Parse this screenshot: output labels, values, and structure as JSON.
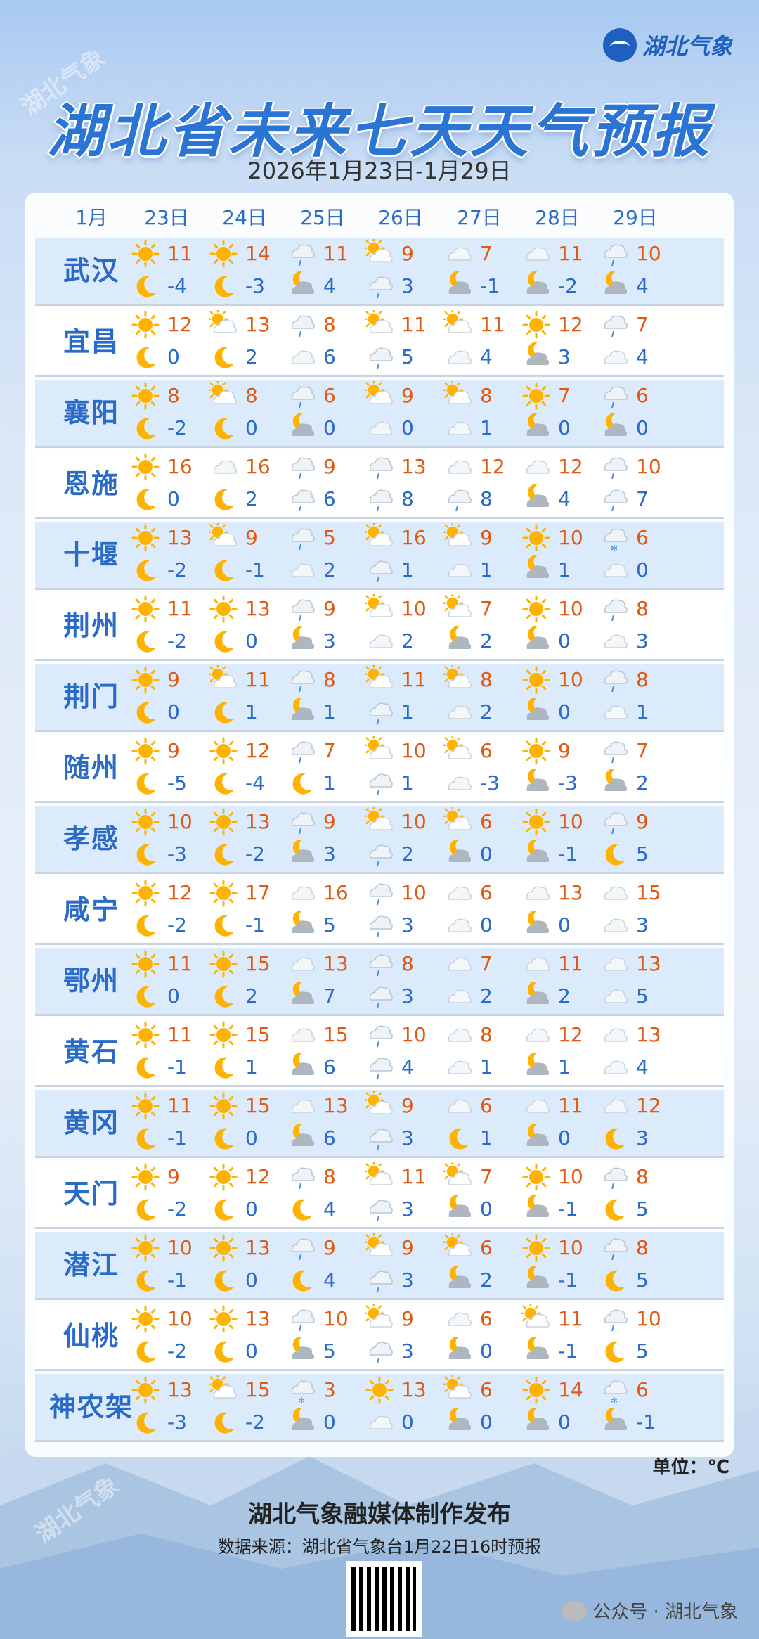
{
  "header": {
    "logo_text": "湖北气象",
    "title": "湖北省未来七天天气预报",
    "subtitle": "2026年1月23日-1月29日",
    "watermark": "湖北气象"
  },
  "table": {
    "month_label": "1月",
    "days": [
      "23日",
      "24日",
      "25日",
      "26日",
      "27日",
      "28日",
      "29日"
    ],
    "rows": [
      {
        "city": "武汉",
        "cells": [
          {
            "hi": "11",
            "lo": "-4",
            "d": "sunny",
            "n": "moon"
          },
          {
            "hi": "14",
            "lo": "-3",
            "d": "sunny",
            "n": "moon"
          },
          {
            "hi": "11",
            "lo": "4",
            "d": "rain",
            "n": "cloud-moon"
          },
          {
            "hi": "9",
            "lo": "3",
            "d": "partly",
            "n": "rain"
          },
          {
            "hi": "7",
            "lo": "-1",
            "d": "cloud",
            "n": "cloud-moon"
          },
          {
            "hi": "11",
            "lo": "-2",
            "d": "cloud",
            "n": "cloud-moon"
          },
          {
            "hi": "10",
            "lo": "4",
            "d": "rain",
            "n": "cloud-moon"
          }
        ]
      },
      {
        "city": "宜昌",
        "cells": [
          {
            "hi": "12",
            "lo": "0",
            "d": "sunny",
            "n": "moon"
          },
          {
            "hi": "13",
            "lo": "2",
            "d": "partly",
            "n": "moon"
          },
          {
            "hi": "8",
            "lo": "6",
            "d": "rain",
            "n": "cloud"
          },
          {
            "hi": "11",
            "lo": "5",
            "d": "partly",
            "n": "rain"
          },
          {
            "hi": "11",
            "lo": "4",
            "d": "partly",
            "n": "cloud"
          },
          {
            "hi": "12",
            "lo": "3",
            "d": "sunny",
            "n": "cloud-moon"
          },
          {
            "hi": "7",
            "lo": "4",
            "d": "rain",
            "n": "cloud"
          }
        ]
      },
      {
        "city": "襄阳",
        "cells": [
          {
            "hi": "8",
            "lo": "-2",
            "d": "sunny",
            "n": "moon"
          },
          {
            "hi": "8",
            "lo": "0",
            "d": "partly",
            "n": "moon"
          },
          {
            "hi": "6",
            "lo": "0",
            "d": "rain",
            "n": "cloud-moon"
          },
          {
            "hi": "9",
            "lo": "0",
            "d": "partly",
            "n": "cloud"
          },
          {
            "hi": "8",
            "lo": "1",
            "d": "partly",
            "n": "cloud"
          },
          {
            "hi": "7",
            "lo": "0",
            "d": "sunny",
            "n": "cloud-moon"
          },
          {
            "hi": "6",
            "lo": "0",
            "d": "rain",
            "n": "cloud-moon"
          }
        ]
      },
      {
        "city": "恩施",
        "cells": [
          {
            "hi": "16",
            "lo": "0",
            "d": "sunny",
            "n": "moon"
          },
          {
            "hi": "16",
            "lo": "2",
            "d": "cloud",
            "n": "moon"
          },
          {
            "hi": "9",
            "lo": "6",
            "d": "rain",
            "n": "rain"
          },
          {
            "hi": "13",
            "lo": "8",
            "d": "rain",
            "n": "rain"
          },
          {
            "hi": "12",
            "lo": "8",
            "d": "cloud",
            "n": "rain"
          },
          {
            "hi": "12",
            "lo": "4",
            "d": "cloud",
            "n": "cloud-moon"
          },
          {
            "hi": "10",
            "lo": "7",
            "d": "rain",
            "n": "rain"
          }
        ]
      },
      {
        "city": "十堰",
        "cells": [
          {
            "hi": "13",
            "lo": "-2",
            "d": "sunny",
            "n": "moon"
          },
          {
            "hi": "9",
            "lo": "-1",
            "d": "partly",
            "n": "moon"
          },
          {
            "hi": "5",
            "lo": "2",
            "d": "rain",
            "n": "cloud"
          },
          {
            "hi": "16",
            "lo": "1",
            "d": "partly",
            "n": "rain"
          },
          {
            "hi": "9",
            "lo": "1",
            "d": "partly",
            "n": "cloud"
          },
          {
            "hi": "10",
            "lo": "1",
            "d": "sunny",
            "n": "cloud-moon"
          },
          {
            "hi": "6",
            "lo": "0",
            "d": "snow",
            "n": "cloud"
          }
        ]
      },
      {
        "city": "荆州",
        "cells": [
          {
            "hi": "11",
            "lo": "-2",
            "d": "sunny",
            "n": "moon"
          },
          {
            "hi": "13",
            "lo": "0",
            "d": "sunny",
            "n": "moon"
          },
          {
            "hi": "9",
            "lo": "3",
            "d": "rain",
            "n": "cloud-moon"
          },
          {
            "hi": "10",
            "lo": "2",
            "d": "partly",
            "n": "cloud"
          },
          {
            "hi": "7",
            "lo": "2",
            "d": "partly",
            "n": "cloud-moon"
          },
          {
            "hi": "10",
            "lo": "0",
            "d": "sunny",
            "n": "cloud-moon"
          },
          {
            "hi": "8",
            "lo": "3",
            "d": "rain",
            "n": "cloud"
          }
        ]
      },
      {
        "city": "荆门",
        "cells": [
          {
            "hi": "9",
            "lo": "0",
            "d": "sunny",
            "n": "moon"
          },
          {
            "hi": "11",
            "lo": "1",
            "d": "partly",
            "n": "moon"
          },
          {
            "hi": "8",
            "lo": "1",
            "d": "rain",
            "n": "cloud-moon"
          },
          {
            "hi": "11",
            "lo": "1",
            "d": "partly",
            "n": "rain"
          },
          {
            "hi": "8",
            "lo": "2",
            "d": "partly",
            "n": "cloud"
          },
          {
            "hi": "10",
            "lo": "0",
            "d": "sunny",
            "n": "cloud-moon"
          },
          {
            "hi": "8",
            "lo": "1",
            "d": "rain",
            "n": "cloud"
          }
        ]
      },
      {
        "city": "随州",
        "cells": [
          {
            "hi": "9",
            "lo": "-5",
            "d": "sunny",
            "n": "moon"
          },
          {
            "hi": "12",
            "lo": "-4",
            "d": "sunny",
            "n": "moon"
          },
          {
            "hi": "7",
            "lo": "1",
            "d": "rain",
            "n": "moon"
          },
          {
            "hi": "10",
            "lo": "1",
            "d": "partly",
            "n": "rain"
          },
          {
            "hi": "6",
            "lo": "-3",
            "d": "partly",
            "n": "cloud"
          },
          {
            "hi": "9",
            "lo": "-3",
            "d": "sunny",
            "n": "cloud-moon"
          },
          {
            "hi": "7",
            "lo": "2",
            "d": "rain",
            "n": "cloud-moon"
          }
        ]
      },
      {
        "city": "孝感",
        "cells": [
          {
            "hi": "10",
            "lo": "-3",
            "d": "sunny",
            "n": "moon"
          },
          {
            "hi": "13",
            "lo": "-2",
            "d": "sunny",
            "n": "moon"
          },
          {
            "hi": "9",
            "lo": "3",
            "d": "rain",
            "n": "cloud-moon"
          },
          {
            "hi": "10",
            "lo": "2",
            "d": "partly",
            "n": "rain"
          },
          {
            "hi": "6",
            "lo": "0",
            "d": "partly",
            "n": "cloud-moon"
          },
          {
            "hi": "10",
            "lo": "-1",
            "d": "sunny",
            "n": "cloud-moon"
          },
          {
            "hi": "9",
            "lo": "5",
            "d": "rain",
            "n": "moon"
          }
        ]
      },
      {
        "city": "咸宁",
        "cells": [
          {
            "hi": "12",
            "lo": "-2",
            "d": "sunny",
            "n": "moon"
          },
          {
            "hi": "17",
            "lo": "-1",
            "d": "sunny",
            "n": "moon"
          },
          {
            "hi": "16",
            "lo": "5",
            "d": "cloud",
            "n": "cloud-moon"
          },
          {
            "hi": "10",
            "lo": "3",
            "d": "rain",
            "n": "rain"
          },
          {
            "hi": "6",
            "lo": "0",
            "d": "cloud",
            "n": "cloud"
          },
          {
            "hi": "13",
            "lo": "0",
            "d": "cloud",
            "n": "cloud-moon"
          },
          {
            "hi": "15",
            "lo": "3",
            "d": "cloud",
            "n": "cloud"
          }
        ]
      },
      {
        "city": "鄂州",
        "cells": [
          {
            "hi": "11",
            "lo": "0",
            "d": "sunny",
            "n": "moon"
          },
          {
            "hi": "15",
            "lo": "2",
            "d": "sunny",
            "n": "moon"
          },
          {
            "hi": "13",
            "lo": "7",
            "d": "cloud",
            "n": "cloud-moon"
          },
          {
            "hi": "8",
            "lo": "3",
            "d": "rain",
            "n": "rain"
          },
          {
            "hi": "7",
            "lo": "2",
            "d": "cloud",
            "n": "cloud"
          },
          {
            "hi": "11",
            "lo": "2",
            "d": "cloud",
            "n": "cloud-moon"
          },
          {
            "hi": "13",
            "lo": "5",
            "d": "cloud",
            "n": "cloud"
          }
        ]
      },
      {
        "city": "黄石",
        "cells": [
          {
            "hi": "11",
            "lo": "-1",
            "d": "sunny",
            "n": "moon"
          },
          {
            "hi": "15",
            "lo": "1",
            "d": "sunny",
            "n": "moon"
          },
          {
            "hi": "15",
            "lo": "6",
            "d": "cloud",
            "n": "cloud-moon"
          },
          {
            "hi": "10",
            "lo": "4",
            "d": "rain",
            "n": "rain"
          },
          {
            "hi": "8",
            "lo": "1",
            "d": "cloud",
            "n": "cloud"
          },
          {
            "hi": "12",
            "lo": "1",
            "d": "cloud",
            "n": "cloud-moon"
          },
          {
            "hi": "13",
            "lo": "4",
            "d": "cloud",
            "n": "cloud"
          }
        ]
      },
      {
        "city": "黄冈",
        "cells": [
          {
            "hi": "11",
            "lo": "-1",
            "d": "sunny",
            "n": "moon"
          },
          {
            "hi": "15",
            "lo": "0",
            "d": "sunny",
            "n": "moon"
          },
          {
            "hi": "13",
            "lo": "6",
            "d": "cloud",
            "n": "cloud-moon"
          },
          {
            "hi": "9",
            "lo": "3",
            "d": "partly",
            "n": "rain"
          },
          {
            "hi": "6",
            "lo": "1",
            "d": "cloud",
            "n": "moon"
          },
          {
            "hi": "11",
            "lo": "0",
            "d": "cloud",
            "n": "cloud-moon"
          },
          {
            "hi": "12",
            "lo": "3",
            "d": "cloud",
            "n": "moon"
          }
        ]
      },
      {
        "city": "天门",
        "cells": [
          {
            "hi": "9",
            "lo": "-2",
            "d": "sunny",
            "n": "moon"
          },
          {
            "hi": "12",
            "lo": "0",
            "d": "sunny",
            "n": "moon"
          },
          {
            "hi": "8",
            "lo": "4",
            "d": "rain",
            "n": "moon"
          },
          {
            "hi": "11",
            "lo": "3",
            "d": "partly",
            "n": "rain"
          },
          {
            "hi": "7",
            "lo": "0",
            "d": "partly",
            "n": "cloud-moon"
          },
          {
            "hi": "10",
            "lo": "-1",
            "d": "sunny",
            "n": "cloud-moon"
          },
          {
            "hi": "8",
            "lo": "5",
            "d": "rain",
            "n": "moon"
          }
        ]
      },
      {
        "city": "潜江",
        "cells": [
          {
            "hi": "10",
            "lo": "-1",
            "d": "sunny",
            "n": "moon"
          },
          {
            "hi": "13",
            "lo": "0",
            "d": "sunny",
            "n": "moon"
          },
          {
            "hi": "9",
            "lo": "4",
            "d": "rain",
            "n": "moon"
          },
          {
            "hi": "9",
            "lo": "3",
            "d": "partly",
            "n": "rain"
          },
          {
            "hi": "6",
            "lo": "2",
            "d": "partly",
            "n": "cloud-moon"
          },
          {
            "hi": "10",
            "lo": "-1",
            "d": "sunny",
            "n": "cloud-moon"
          },
          {
            "hi": "8",
            "lo": "5",
            "d": "rain",
            "n": "moon"
          }
        ]
      },
      {
        "city": "仙桃",
        "cells": [
          {
            "hi": "10",
            "lo": "-2",
            "d": "sunny",
            "n": "moon"
          },
          {
            "hi": "13",
            "lo": "0",
            "d": "sunny",
            "n": "moon"
          },
          {
            "hi": "10",
            "lo": "5",
            "d": "rain",
            "n": "cloud-moon"
          },
          {
            "hi": "9",
            "lo": "3",
            "d": "partly",
            "n": "rain"
          },
          {
            "hi": "6",
            "lo": "0",
            "d": "cloud",
            "n": "cloud-moon"
          },
          {
            "hi": "11",
            "lo": "-1",
            "d": "partly",
            "n": "cloud-moon"
          },
          {
            "hi": "10",
            "lo": "5",
            "d": "rain",
            "n": "moon"
          }
        ]
      },
      {
        "city": "神农架",
        "cells": [
          {
            "hi": "13",
            "lo": "-3",
            "d": "sunny",
            "n": "moon"
          },
          {
            "hi": "15",
            "lo": "-2",
            "d": "partly",
            "n": "moon"
          },
          {
            "hi": "3",
            "lo": "0",
            "d": "snow",
            "n": "cloud-moon"
          },
          {
            "hi": "13",
            "lo": "0",
            "d": "sunny",
            "n": "cloud"
          },
          {
            "hi": "6",
            "lo": "0",
            "d": "partly",
            "n": "cloud-moon"
          },
          {
            "hi": "14",
            "lo": "0",
            "d": "sunny",
            "n": "cloud-moon"
          },
          {
            "hi": "6",
            "lo": "-1",
            "d": "snow",
            "n": "cloud-moon"
          }
        ]
      }
    ]
  },
  "unit_label": "单位：℃",
  "footer": {
    "publisher": "湖北气象融媒体制作发布",
    "source": "数据来源：湖北省气象台1月22日16时预报",
    "wechat": "公众号 · 湖北气象"
  },
  "colors": {
    "title": "#2a74d6",
    "high": "#e05a12",
    "low": "#2a6bc8",
    "row_alt": "#dcebfb"
  }
}
